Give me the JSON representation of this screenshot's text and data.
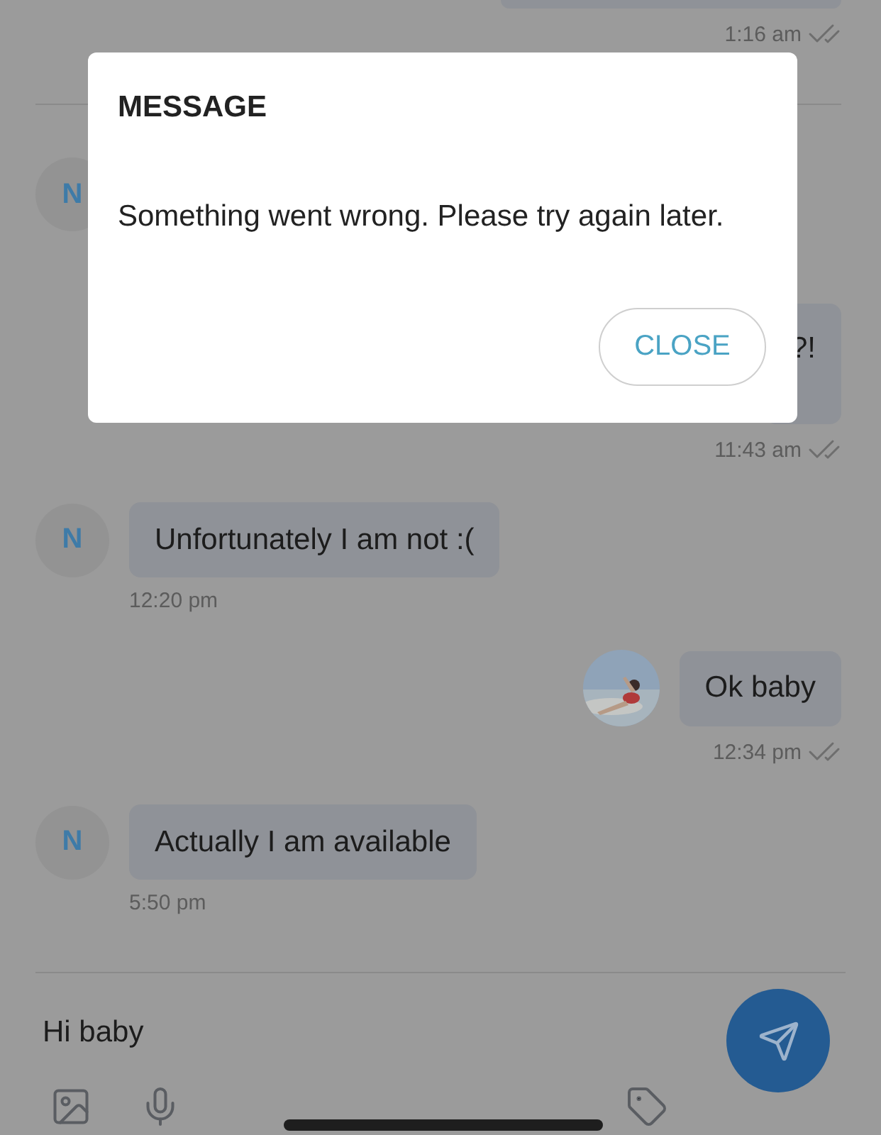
{
  "messages": [
    {
      "kind": "outgoing",
      "time": "1:16 am",
      "read": true
    },
    {
      "kind": "incoming",
      "avatar": "N"
    },
    {
      "kind": "outgoing",
      "text": "?!",
      "time": "11:43 am",
      "read": true
    },
    {
      "kind": "incoming",
      "avatar": "N",
      "text": "Unfortunately I am not :(",
      "time": "12:20 pm"
    },
    {
      "kind": "outgoing",
      "avatar_picture": true,
      "text": "Ok baby",
      "time": "12:34 pm",
      "read": true
    },
    {
      "kind": "incoming",
      "avatar": "N",
      "text": "Actually I am available",
      "time": "5:50 pm"
    }
  ],
  "composer": {
    "value": "Hi baby"
  },
  "dialog": {
    "title": "MESSAGE",
    "message": "Something went wrong. Please try again later.",
    "button": "CLOSE"
  }
}
